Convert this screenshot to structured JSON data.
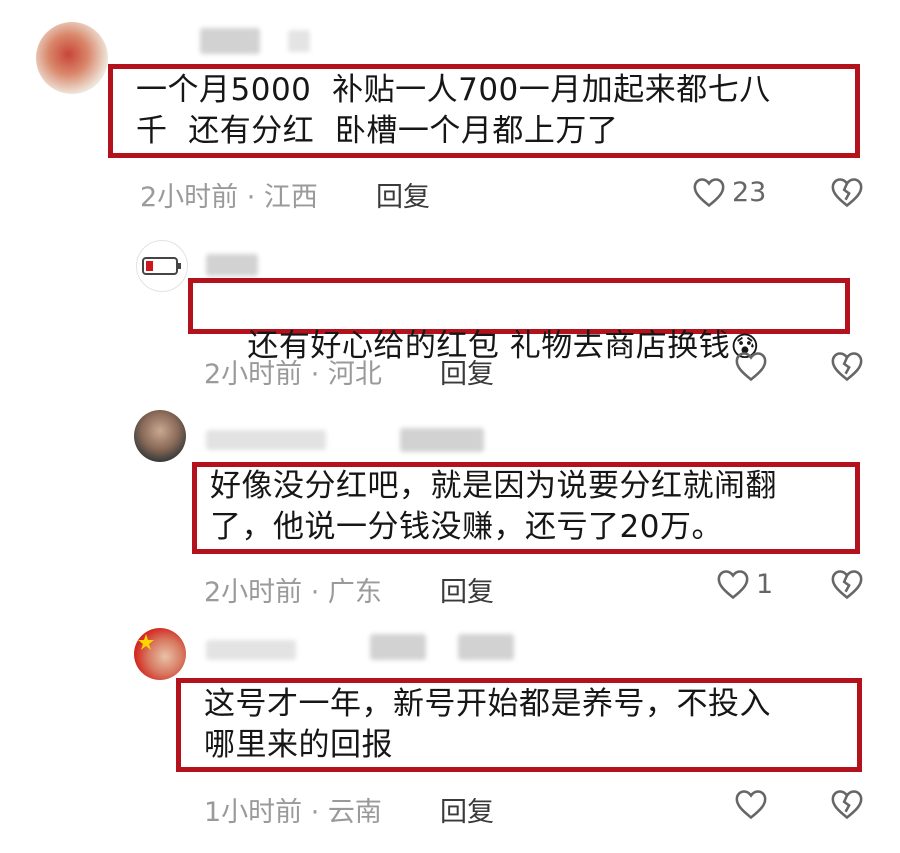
{
  "colors": {
    "highlight_box": "#b3121c",
    "meta": "#9a9a9a"
  },
  "comments": [
    {
      "text": "一个月5000  补贴一人700一月加起来都七八\n千  还有分红  卧槽一个月都上万了",
      "time_location": "2小时前 · 江西",
      "reply_label": "回复",
      "likes": "23",
      "icons": [
        "avatar-flower",
        "heart-icon",
        "broken-heart-icon"
      ]
    },
    {
      "text": "还有好心给的红包 礼物去商店换钱",
      "emoji": "😰",
      "time_location": "2小时前 · 河北",
      "reply_label": "回复",
      "likes": "",
      "icons": [
        "avatar-battery",
        "heart-icon",
        "broken-heart-icon"
      ]
    },
    {
      "text": "好像没分红吧，就是因为说要分红就闹翻\n了，他说一分钱没赚，还亏了20万。",
      "time_location": "2小时前 · 广东",
      "reply_label": "回复",
      "likes": "1",
      "icons": [
        "avatar-person",
        "heart-icon",
        "broken-heart-icon"
      ]
    },
    {
      "text": "这号才一年，新号开始都是养号，不投入\n哪里来的回报",
      "time_location": "1小时前 · 云南",
      "reply_label": "回复",
      "likes": "",
      "icons": [
        "avatar-flag",
        "heart-icon",
        "broken-heart-icon"
      ]
    }
  ]
}
